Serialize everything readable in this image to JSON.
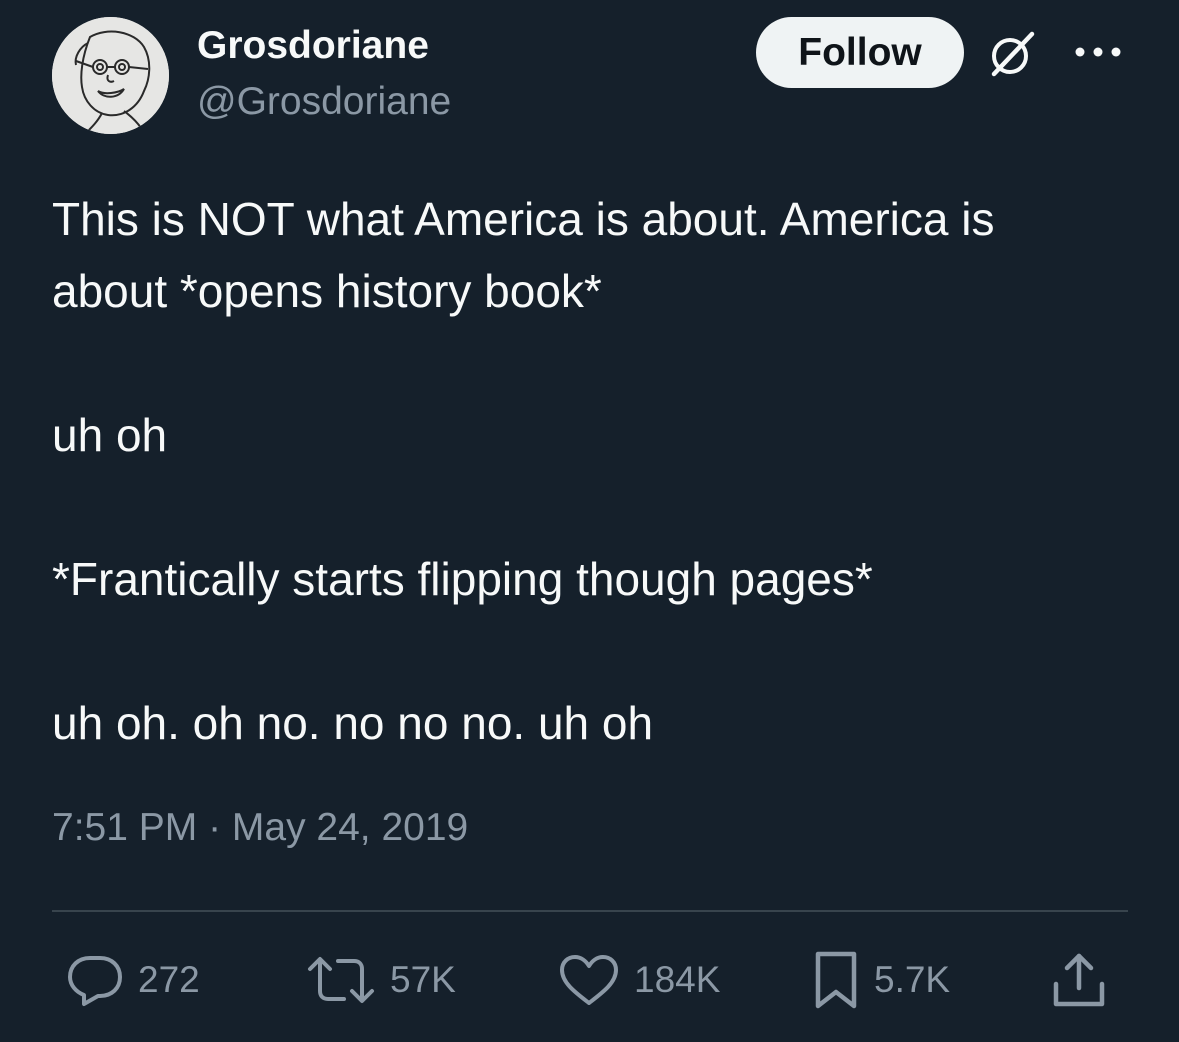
{
  "author": {
    "display_name": "Grosdoriane",
    "handle": "@Grosdoriane"
  },
  "header": {
    "follow_label": "Follow",
    "grok_icon": "grok-icon",
    "more_icon": "more-options-icon"
  },
  "tweet": {
    "text": "This is NOT what America is about. America is\nabout *opens history book*\n\nuh oh\n\n*Frantically starts flipping though pages*\n\nuh oh. oh no. no no no. uh oh",
    "timestamp": "7:51 PM · May 24, 2019"
  },
  "actions": {
    "replies": "272",
    "reposts": "57K",
    "likes": "184K",
    "bookmarks": "5.7K"
  },
  "colors": {
    "background": "#15202b",
    "text_primary": "#f7f9f9",
    "text_secondary": "#8b98a5",
    "divider": "#38444d",
    "follow_bg": "#eff3f4"
  }
}
